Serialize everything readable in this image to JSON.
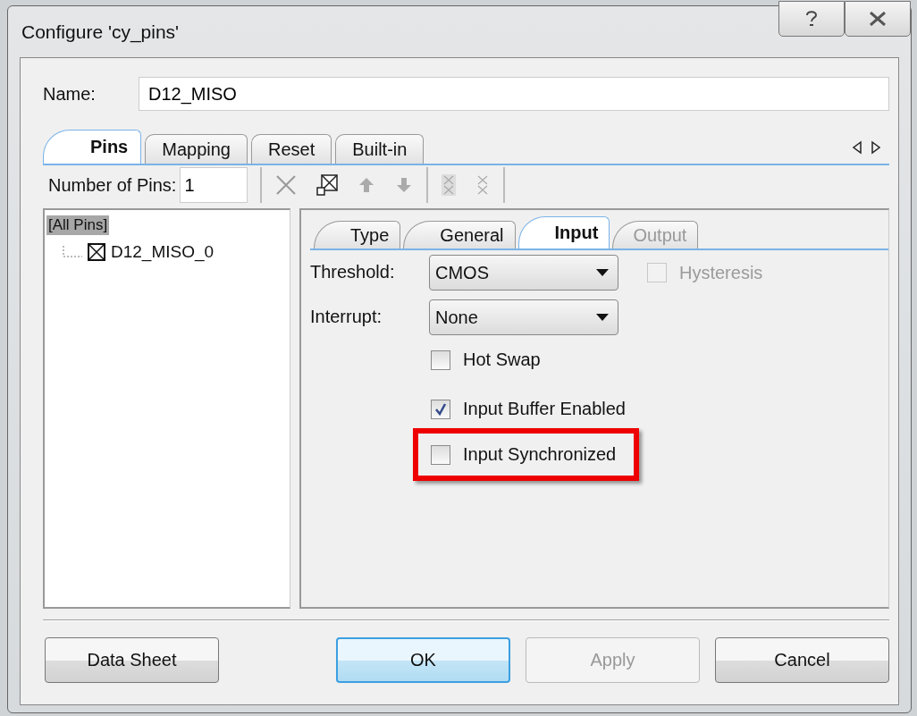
{
  "window": {
    "title": "Configure 'cy_pins'"
  },
  "name_field": {
    "label": "Name:",
    "value": "D12_MISO"
  },
  "tabs": [
    {
      "label": "Pins",
      "selected": true
    },
    {
      "label": "Mapping",
      "selected": false
    },
    {
      "label": "Reset",
      "selected": false
    },
    {
      "label": "Built-in",
      "selected": false
    }
  ],
  "pins_toolbar": {
    "label": "Number of Pins:",
    "value": "1"
  },
  "tree": {
    "label": "[All Pins]",
    "selected": true,
    "children": [
      {
        "label": "D12_MISO_0"
      }
    ]
  },
  "inner_tabs": [
    {
      "label": "Type",
      "selected": false,
      "disabled": false
    },
    {
      "label": "General",
      "selected": false,
      "disabled": false
    },
    {
      "label": "Input",
      "selected": true,
      "disabled": false
    },
    {
      "label": "Output",
      "selected": false,
      "disabled": true
    }
  ],
  "threshold": {
    "label": "Threshold:",
    "value": "CMOS"
  },
  "hysteresis": {
    "label": "Hysteresis",
    "checked": false,
    "disabled": true
  },
  "interrupt": {
    "label": "Interrupt:",
    "value": "None"
  },
  "checkboxes": [
    {
      "label": "Hot Swap",
      "checked": false,
      "highlighted": false
    },
    {
      "label": "Input Buffer Enabled",
      "checked": true,
      "highlighted": false
    },
    {
      "label": "Input Synchronized",
      "checked": false,
      "highlighted": true
    }
  ],
  "buttons": [
    {
      "label": "Data Sheet",
      "default": false,
      "disabled": false
    },
    {
      "label": "OK",
      "default": true,
      "disabled": false
    },
    {
      "label": "Apply",
      "default": false,
      "disabled": true
    },
    {
      "label": "Cancel",
      "default": false,
      "disabled": false
    }
  ]
}
